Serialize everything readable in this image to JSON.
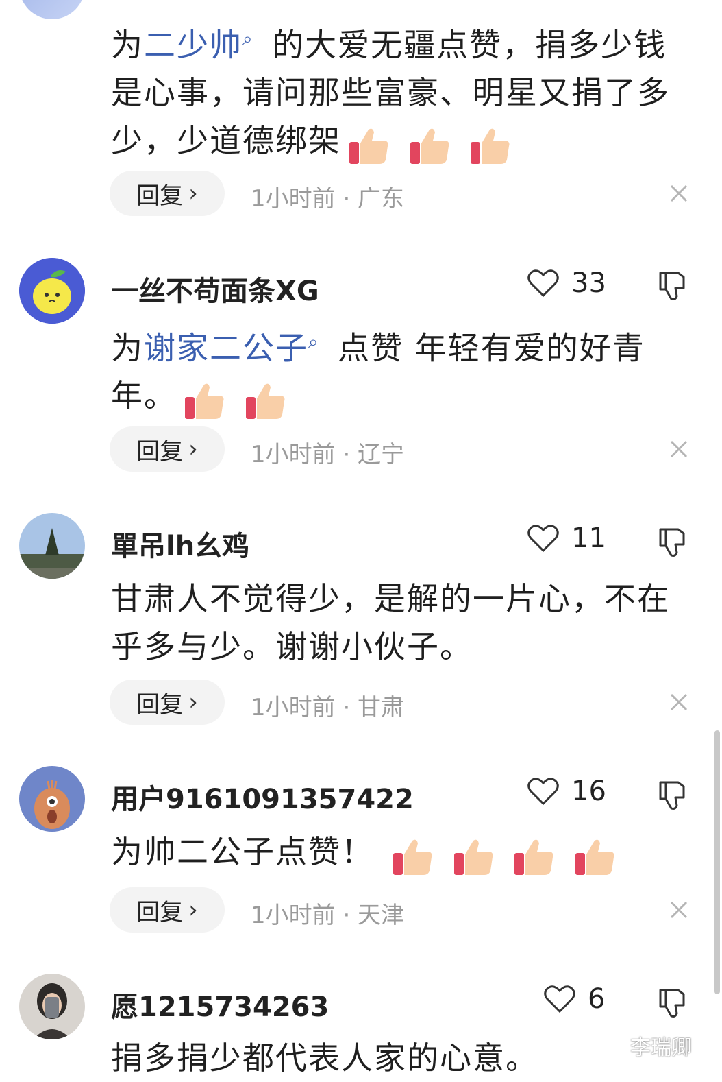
{
  "actions": {
    "reply_label": "回复"
  },
  "comments": [
    {
      "username": "",
      "likes": "",
      "text_prefix": "为",
      "link": "二少帅",
      "text_suffix": " 的大爱无疆点赞，捐多少钱是心事，请问那些富豪、明星又捐了多少，少道德绑架",
      "thumbs_count": 3,
      "meta": "1小时前 · 广东"
    },
    {
      "username": "一丝不苟面条XG",
      "likes": "33",
      "text_prefix": "为",
      "link": "谢家二公子",
      "text_suffix": " 点赞 年轻有爱的好青年。",
      "thumbs_count": 2,
      "meta": "1小时前 · 辽宁"
    },
    {
      "username": "單吊lh幺鸡",
      "likes": "11",
      "text": "甘肃人不觉得少，是解的一片心，不在乎多与少。谢谢小伙子。",
      "meta": "1小时前 · 甘肃"
    },
    {
      "username": "用户9161091357422",
      "likes": "16",
      "text": "为帅二公子点赞！",
      "thumbs_count": 4,
      "meta": "1小时前 · 天津"
    },
    {
      "username": "愿1215734263",
      "likes": "6",
      "text": "捐多捐少都代表人家的心意。"
    }
  ],
  "icons": {
    "heart": "heart-outline-icon",
    "dislike": "thumb-down-icon",
    "close": "close-icon",
    "search_mark": "search-icon",
    "thumb": "thumbs-up-emoji"
  },
  "colors": {
    "link": "#3b5fb0",
    "meta": "#9a9a9a",
    "pill": "#f3f3f3"
  },
  "watermark": "李瑞卿"
}
